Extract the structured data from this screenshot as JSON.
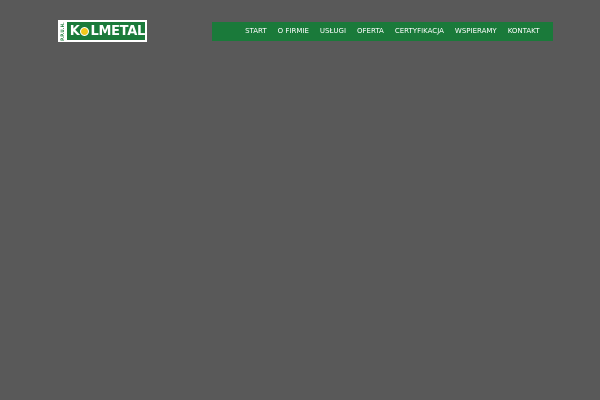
{
  "header": {
    "logo": {
      "tag_text": "P.P.U.H.",
      "name_before": "K",
      "name_after": "LMETAL"
    },
    "nav": {
      "items": [
        {
          "label": "START"
        },
        {
          "label": "O FIRMIE"
        },
        {
          "label": "USŁUGI"
        },
        {
          "label": "OFERTA"
        },
        {
          "label": "CERTYFIKACJA"
        },
        {
          "label": "WSPIERAMY"
        },
        {
          "label": "KONTAKT"
        }
      ]
    }
  },
  "colors": {
    "background": "#595959",
    "brand_green": "#1a7a3a",
    "logo_sun": "#f2c81c",
    "text_light": "#ffffff"
  }
}
